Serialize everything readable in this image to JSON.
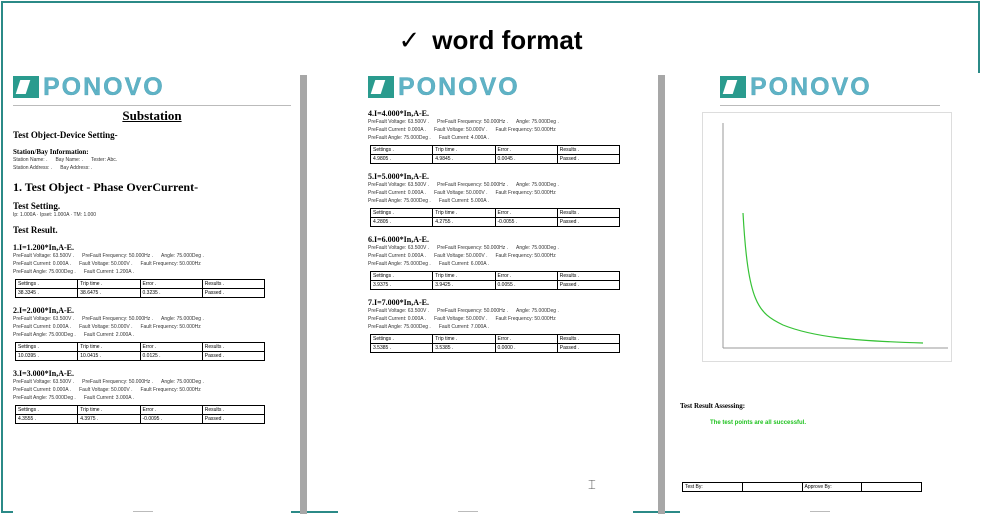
{
  "header": {
    "check": "✓",
    "title": "word format"
  },
  "brand": "PONOVO",
  "page1": {
    "title": "Substation",
    "test_object_setting": "Test Object-Device Setting-",
    "station_info": "Station/Bay Information:",
    "station_name": "Station Name: .",
    "bay_name": "Bay Name: .",
    "tester": "Tester: Abc.",
    "station_address": "Station Address: .",
    "bay_address": "Bay Address: .",
    "section1": "1.  Test Object - Phase OverCurrent-",
    "test_setting": "Test Setting.",
    "setting_line": "Ip: 1.000A ·   Ipset: 1.000A ·   TM: 1.000",
    "test_result": "Test Result.",
    "blocks": [
      {
        "title": "1.I=1.200*In,A-E.",
        "volt": "PreFault Voltage: 63.500V .",
        "freq": "PreFault Frequency: 50.000Hz .",
        "angle": "Angle: 75.000Deg .",
        "cur": "PreFault Current: 0.000A .",
        "fvolt": "Fault Voltage: 50.000V .",
        "ffreq": "Fault Frequency: 50.000Hz",
        "pangle": "PreFault Angle: 75.000Deg .",
        "fcur": "Fault Current: 1.200A .",
        "row": [
          "38.3345 .",
          "38.6475 .",
          "0.3235 .",
          "Passed ."
        ]
      },
      {
        "title": "2.I=2.000*In,A-E.",
        "volt": "PreFault Voltage: 63.500V .",
        "freq": "PreFault Frequency: 50.000Hz .",
        "angle": "Angle: 75.000Deg .",
        "cur": "PreFault Current: 0.000A .",
        "fvolt": "Fault Voltage: 50.000V .",
        "ffreq": "Fault Frequency: 50.000Hz",
        "pangle": "PreFault Angle: 75.000Deg .",
        "fcur": "Fault Current: 2.000A .",
        "row": [
          "10.0395 .",
          "10.0415 .",
          "0.0125 .",
          "Passed ."
        ]
      },
      {
        "title": "3.I=3.000*In,A-E.",
        "volt": "PreFault Voltage: 63.500V .",
        "freq": "PreFault Frequency: 50.000Hz .",
        "angle": "Angle: 75.000Deg .",
        "cur": "PreFault Current: 0.000A .",
        "fvolt": "Fault Voltage: 50.000V .",
        "ffreq": "Fault Frequency: 50.000Hz",
        "pangle": "PreFault Angle: 75.000Deg .",
        "fcur": "Fault Current: 3.000A .",
        "row": [
          "4.3555 .",
          "4.3975 .",
          "-0.0095 .",
          "Passed ."
        ]
      }
    ]
  },
  "page2": {
    "blocks": [
      {
        "title": "4.I=4.000*In,A-E.",
        "volt": "PreFault Voltage: 63.500V .",
        "freq": "PreFault Frequency: 50.000Hz .",
        "angle": "Angle: 75.000Deg .",
        "cur": "PreFault Current: 0.000A .",
        "fvolt": "Fault Voltage: 50.000V .",
        "ffreq": "Fault Frequency: 50.000Hz",
        "pangle": "PreFault Angle: 75.000Deg .",
        "fcur": "Fault Current: 4.000A .",
        "row": [
          "4.9805 .",
          "4.9845 .",
          "0.0045 .",
          "Passed ."
        ]
      },
      {
        "title": "5.I=5.000*In,A-E.",
        "volt": "PreFault Voltage: 63.500V .",
        "freq": "PreFault Frequency: 50.000Hz .",
        "angle": "Angle: 75.000Deg .",
        "cur": "PreFault Current: 0.000A .",
        "fvolt": "Fault Voltage: 50.000V .",
        "ffreq": "Fault Frequency: 50.000Hz",
        "pangle": "PreFault Angle: 75.000Deg .",
        "fcur": "Fault Current: 5.000A .",
        "row": [
          "4.2805 .",
          "4.2755 .",
          "-0.0055 .",
          "Passed ."
        ]
      },
      {
        "title": "6.I=6.000*In,A-E.",
        "volt": "PreFault Voltage: 63.500V .",
        "freq": "PreFault Frequency: 50.000Hz .",
        "angle": "Angle: 75.000Deg .",
        "cur": "PreFault Current: 0.000A .",
        "fvolt": "Fault Voltage: 50.000V .",
        "ffreq": "Fault Frequency: 50.000Hz",
        "pangle": "PreFault Angle: 75.000Deg .",
        "fcur": "Fault Current: 6.000A .",
        "row": [
          "3.9375 .",
          "3.9425 .",
          "0.0055 .",
          "Passed ."
        ]
      },
      {
        "title": "7.I=7.000*In,A-E.",
        "volt": "PreFault Voltage: 63.500V .",
        "freq": "PreFault Frequency: 50.000Hz .",
        "angle": "Angle: 75.000Deg .",
        "cur": "PreFault Current: 0.000A .",
        "fvolt": "Fault Voltage: 50.000V .",
        "ffreq": "Fault Frequency: 50.000Hz",
        "pangle": "PreFault Angle: 75.000Deg .",
        "fcur": "Fault Current: 7.000A .",
        "row": [
          "3.5385 .",
          "3.5385 .",
          "0.0000 .",
          "Passed ."
        ]
      }
    ]
  },
  "page3": {
    "assessing": "Test Result Assessing:",
    "passed": "The test points are all successful.",
    "test_by": "Test By:",
    "approve_by": "Approve By:"
  },
  "table_headers": [
    "Settings .",
    "Trip time .",
    "Error .",
    "Results ."
  ]
}
